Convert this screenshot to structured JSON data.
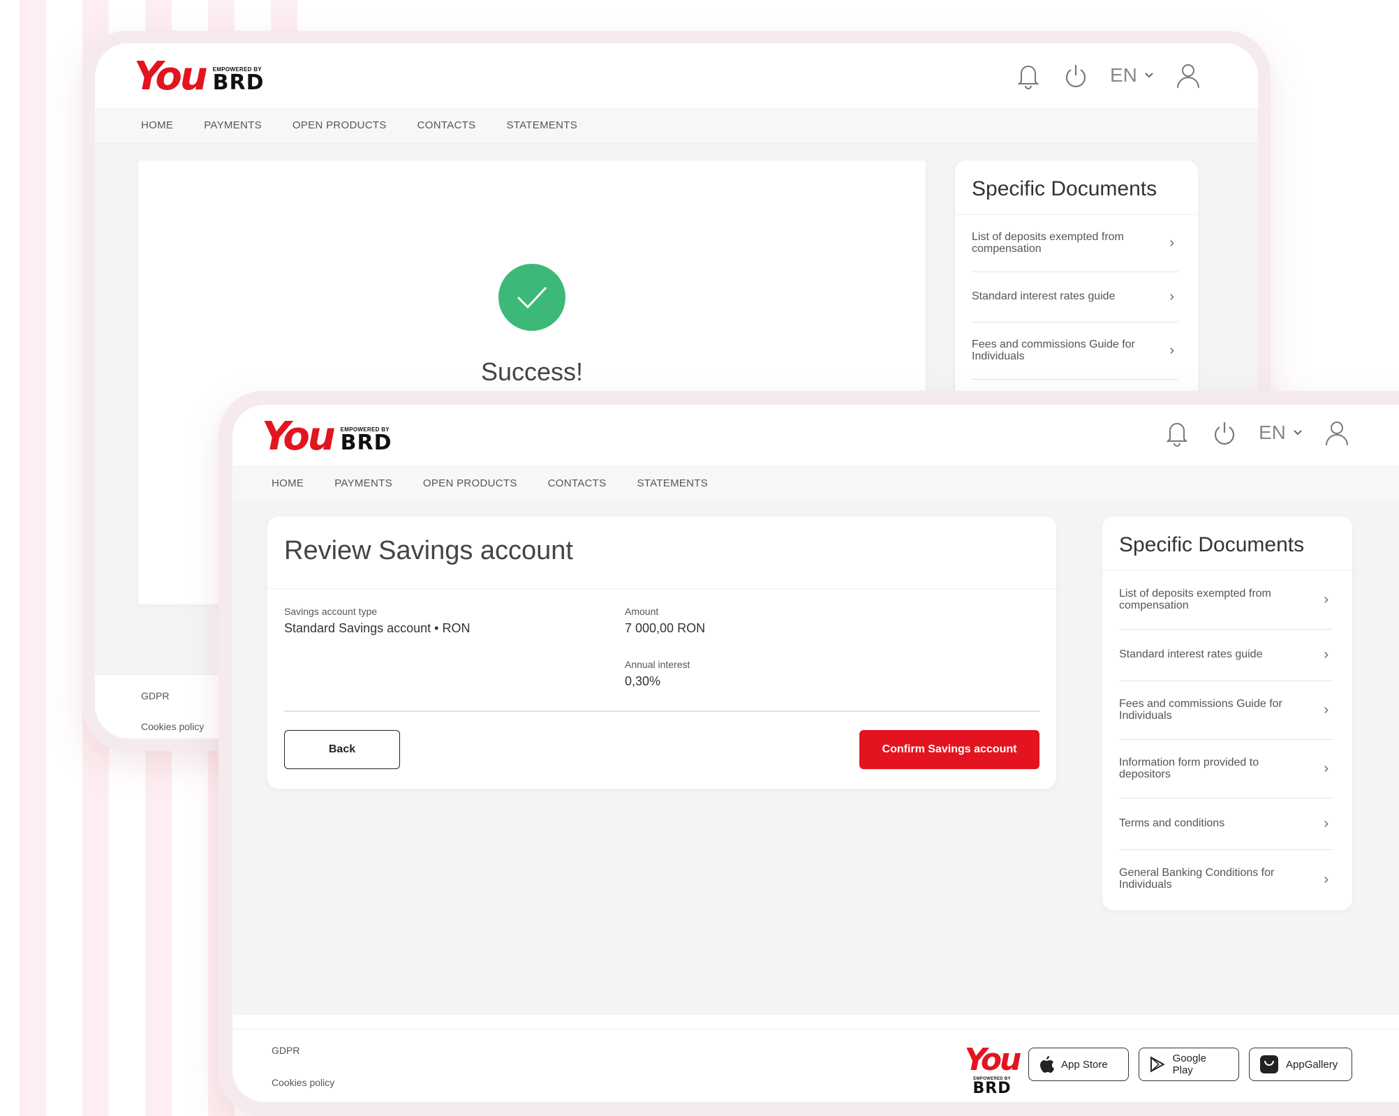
{
  "brand": {
    "logo_you": "You",
    "logo_empowered": "EMPOWERED BY",
    "logo_brd": "BRD",
    "accent_color": "#e3141f",
    "success_color": "#3cb878"
  },
  "header": {
    "language": "EN",
    "icons": [
      "bell-icon",
      "power-icon",
      "chevron-down-icon",
      "user-icon"
    ]
  },
  "nav": {
    "items": [
      "HOME",
      "PAYMENTS",
      "OPEN PRODUCTS",
      "CONTACTS",
      "STATEMENTS"
    ]
  },
  "success_screen": {
    "message": "Success!",
    "documents": {
      "title": "Specific Documents",
      "items": [
        "List of deposits exempted from compensation",
        "Standard interest rates guide",
        "Fees and commissions Guide for Individuals"
      ]
    },
    "footer": {
      "gdpr": "GDPR",
      "cookies": "Cookies policy"
    }
  },
  "review_screen": {
    "title": "Review Savings account",
    "account_type_label": "Savings account type",
    "account_type_value": "Standard Savings account • RON",
    "amount_label": "Amount",
    "amount_value": "7 000,00 RON",
    "interest_label": "Annual interest",
    "interest_value": "0,30%",
    "back_button": "Back",
    "confirm_button": "Confirm Savings account",
    "documents": {
      "title": "Specific Documents",
      "items": [
        "List of deposits exempted from compensation",
        "Standard interest rates guide",
        "Fees and commissions Guide for Individuals",
        "Information form provided to depositors",
        "Terms and conditions",
        "General Banking Conditions for Individuals"
      ]
    },
    "footer": {
      "gdpr": "GDPR",
      "cookies": "Cookies policy",
      "app_store": "App Store",
      "google_play": "Google Play",
      "app_gallery": "AppGallery"
    }
  }
}
